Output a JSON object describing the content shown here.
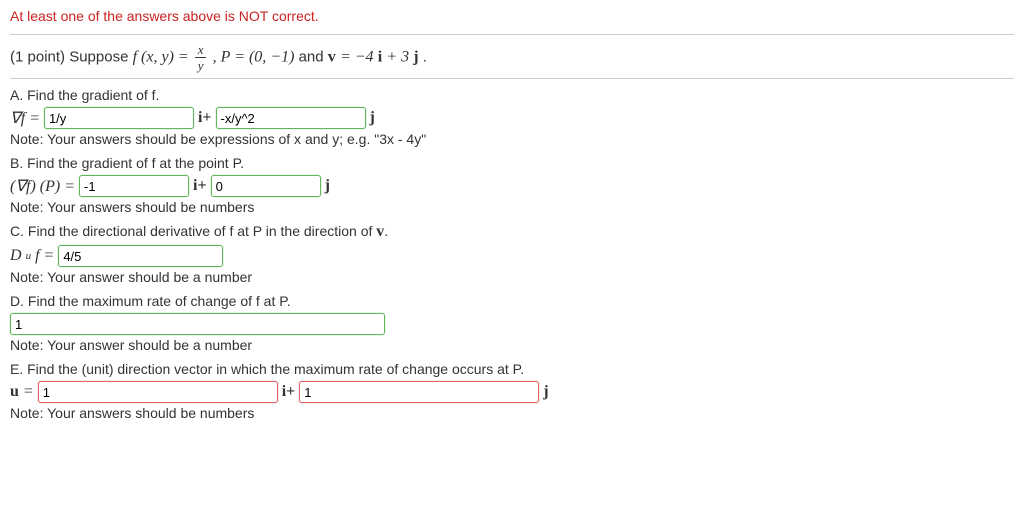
{
  "warning": "At least one of the answers above is NOT correct.",
  "problem": {
    "points": "(1 point)",
    "prefix": "Suppose ",
    "func": "f (x, y) = ",
    "frac_num": "x",
    "frac_den": "y",
    "mid1": ", ",
    "P_text": "P = (0, −1)",
    "mid2": " and ",
    "v_lhs": "v",
    "v_eq": " = −4",
    "v_i": "i",
    "v_plus": " + 3",
    "v_j": "j",
    "period": "."
  },
  "partA": {
    "label": "A. Find the gradient of f.",
    "lhs": "∇f = ",
    "input1": "1/y",
    "iplus": "i+",
    "input2": "-x/y^2",
    "j": "j",
    "note": "Note: Your answers should be expressions of x and y; e.g. \"3x - 4y\""
  },
  "partB": {
    "label": "B. Find the gradient of f at the point P.",
    "lhs": "(∇f) (P) = ",
    "input1": "-1",
    "iplus": "i+",
    "input2": "0",
    "j": "j",
    "note": "Note: Your answers should be numbers"
  },
  "partC": {
    "label_pre": "C. Find the directional derivative of f at P in the direction of ",
    "label_v": "v",
    "label_post": ".",
    "lhs_D": "D",
    "lhs_u": "u",
    "lhs_f": "f = ",
    "input": "4/5",
    "note": "Note: Your answer should be a number"
  },
  "partD": {
    "label": "D. Find the maximum rate of change of f at P.",
    "input": "1",
    "note": "Note: Your answer should be a number"
  },
  "partE": {
    "label": "E. Find the (unit) direction vector in which the maximum rate of change occurs at P.",
    "lhs_u": "u",
    "lhs_eq": " = ",
    "input1": "1",
    "iplus": "i+",
    "input2": "1",
    "j": "j",
    "note": "Note: Your answers should be numbers"
  }
}
